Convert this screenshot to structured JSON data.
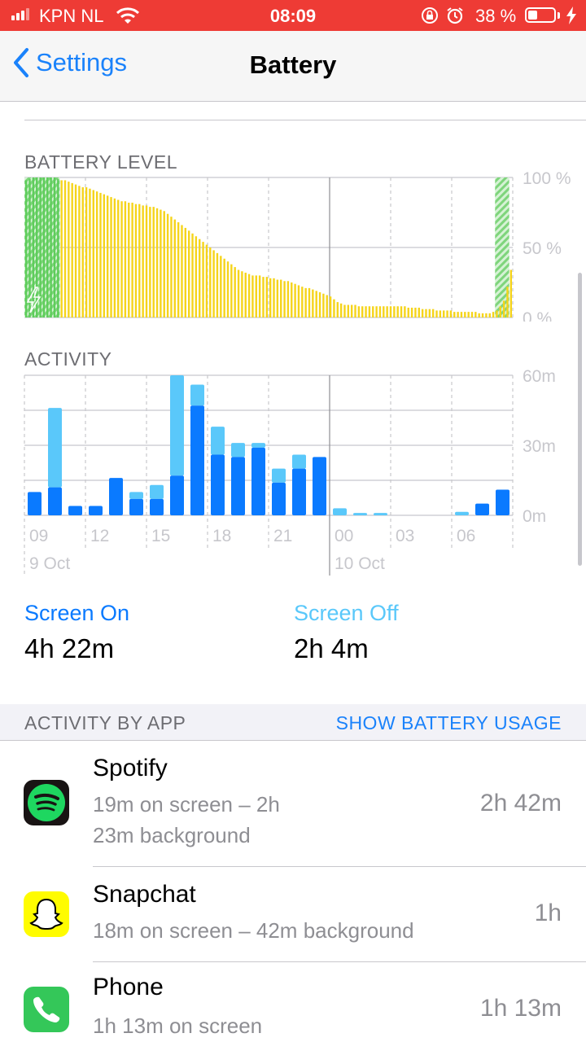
{
  "status_bar": {
    "carrier": "KPN NL",
    "time": "08:09",
    "battery_percent": "38 %",
    "battery_level": 0.38,
    "icons": [
      "signal-icon",
      "wifi-icon",
      "orientation-lock-icon",
      "alarm-icon",
      "battery-icon",
      "charging-bolt-icon"
    ]
  },
  "nav": {
    "back_label": "Settings",
    "title": "Battery"
  },
  "battery_level_label": "BATTERY LEVEL",
  "activity_label": "ACTIVITY",
  "chart_data": [
    {
      "type": "bar",
      "title": "BATTERY LEVEL",
      "ylim": [
        0,
        100
      ],
      "y_ticks": [
        "100 %",
        "50 %",
        "0 %"
      ],
      "values": [
        98,
        99,
        100,
        100,
        100,
        100,
        100,
        100,
        100,
        99,
        98,
        98,
        97,
        96,
        95,
        94,
        93,
        93,
        92,
        91,
        90,
        89,
        88,
        87,
        86,
        85,
        84,
        83,
        83,
        82,
        82,
        81,
        81,
        80,
        80,
        79,
        79,
        78,
        77,
        76,
        74,
        72,
        70,
        68,
        66,
        64,
        62,
        60,
        58,
        56,
        54,
        52,
        50,
        48,
        46,
        44,
        42,
        40,
        38,
        36,
        34,
        33,
        32,
        31,
        30,
        30,
        30,
        29,
        29,
        28,
        28,
        27,
        27,
        26,
        26,
        25,
        24,
        23,
        22,
        21,
        21,
        20,
        19,
        18,
        17,
        16,
        15,
        13,
        11,
        10,
        9,
        9,
        9,
        9,
        8,
        8,
        8,
        8,
        8,
        8,
        8,
        8,
        8,
        8,
        8,
        8,
        8,
        8,
        7,
        7,
        7,
        7,
        6,
        6,
        6,
        6,
        5,
        5,
        5,
        5,
        5,
        4,
        4,
        4,
        4,
        4,
        4,
        4,
        3,
        3,
        3,
        3,
        4,
        5,
        8,
        12,
        22,
        34
      ],
      "charging_periods": [
        [
          0,
          9
        ],
        [
          133,
          136
        ]
      ],
      "colors": {
        "battery": "#f5d41a",
        "charging": "#5ecd5b"
      }
    },
    {
      "type": "bar",
      "title": "ACTIVITY",
      "ylim": [
        0,
        60
      ],
      "y_ticks": [
        "60m",
        "30m",
        "0m"
      ],
      "categories": [
        "09",
        "10",
        "11",
        "12",
        "13",
        "14",
        "15",
        "16",
        "17",
        "18",
        "19",
        "20",
        "21",
        "22",
        "23",
        "00",
        "01",
        "02",
        "03",
        "04",
        "05",
        "06",
        "07",
        "08"
      ],
      "x_tick_labels": [
        "09",
        "12",
        "15",
        "18",
        "21",
        "00",
        "03",
        "06"
      ],
      "date_labels": [
        "9 Oct",
        "10 Oct"
      ],
      "series": [
        {
          "name": "Screen On",
          "color": "#0a7aff",
          "values": [
            10,
            12,
            4,
            4,
            16,
            7,
            7,
            17,
            47,
            26,
            25,
            29,
            14,
            20,
            25,
            0,
            0,
            0,
            0,
            0,
            0,
            0,
            5,
            11
          ]
        },
        {
          "name": "Screen Off",
          "color": "#5ac8fa",
          "values": [
            0,
            34,
            0,
            0,
            0,
            3,
            6,
            43,
            9,
            12,
            6,
            2,
            6,
            6,
            0,
            3,
            1,
            1,
            0,
            0,
            0,
            1.5,
            0,
            0
          ]
        }
      ]
    }
  ],
  "summary": {
    "screen_on_label": "Screen On",
    "screen_on_value": "4h 22m",
    "screen_off_label": "Screen Off",
    "screen_off_value": "2h 4m"
  },
  "activity_by_app": {
    "header": "ACTIVITY BY APP",
    "link": "SHOW BATTERY USAGE",
    "apps": [
      {
        "name": "Spotify",
        "detail": "19m on screen – 2h 23m background",
        "time": "2h 42m",
        "icon": "spotify-icon"
      },
      {
        "name": "Snapchat",
        "detail": "18m on screen – 42m background",
        "time": "1h",
        "icon": "snapchat-icon"
      },
      {
        "name": "Phone",
        "detail": "1h 13m on screen",
        "time": "1h 13m",
        "icon": "phone-icon"
      }
    ]
  }
}
